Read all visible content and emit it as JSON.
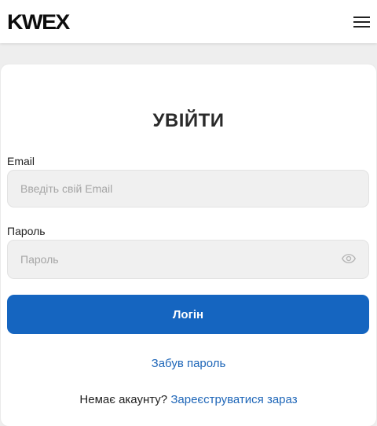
{
  "header": {
    "logo_text": "KWEX",
    "menu_icon": "hamburger-menu-icon"
  },
  "form": {
    "title": "УВІЙТИ",
    "email": {
      "label": "Email",
      "placeholder": "Введіть свій Email",
      "value": ""
    },
    "password": {
      "label": "Пароль",
      "placeholder": "Пароль",
      "value": "",
      "toggle_icon": "eye-icon"
    },
    "login_label": "Логін",
    "forgot_label": "Забув пароль",
    "no_account_text": "Немає акаунту?",
    "signup_link": "Зареєструватися зараз"
  },
  "colors": {
    "primary": "#1565c0",
    "link": "#1e66b8",
    "page_background": "#eeeeee",
    "field_background": "#f0f0f0"
  }
}
